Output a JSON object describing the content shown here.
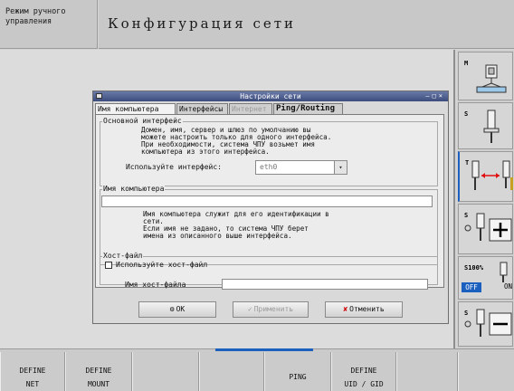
{
  "header": {
    "mode_line1": "Режим ручного",
    "mode_line2": "управления",
    "title": "Конфигурация сети"
  },
  "dialog": {
    "title": "Настройки сети",
    "tabs": [
      {
        "label": "Имя компьютера",
        "state": "selected"
      },
      {
        "label": "Интерфейсы",
        "state": "normal"
      },
      {
        "label": "Интернет",
        "state": "disabled"
      },
      {
        "label": "Ping/Routing",
        "state": "normal"
      }
    ],
    "main_interface": {
      "group_title": "Основной интерфейс",
      "line1": "Домен, имя, сервер и шлюз по умолчанию вы",
      "line2": "можете настроить только для одного интерфейса.",
      "line3": "При необходимости, система ЧПУ возьмет имя",
      "line4": "компьютера из этого интерфейса.",
      "use_interface_label": "Используйте интерфейс:",
      "interface_value": "eth0"
    },
    "computer_name": {
      "group_title": "Имя компьютера",
      "value": "",
      "line1": "Имя компьютера служит для его идентификации в",
      "line2": "сети.",
      "line3": "Если имя не задано, то система ЧПУ берет",
      "line4": "имена из описанного выше интерфейса."
    },
    "host_file": {
      "group_title": "Хост-файл",
      "checkbox_label": "Используйте хост-файл",
      "checkbox_checked": false,
      "name_label": "Имя хост-файла",
      "name_value": ""
    },
    "buttons": {
      "ok": "OK",
      "apply": "Применить",
      "cancel": "Отменить"
    }
  },
  "side_softkeys": [
    {
      "label": "M"
    },
    {
      "label": "S"
    },
    {
      "label": "T"
    },
    {
      "label": "S"
    },
    {
      "label": "S100%",
      "off": "OFF",
      "on": "ON"
    },
    {
      "label": "S"
    }
  ],
  "bottom_softkeys": [
    {
      "line1": "DEFINE",
      "line2": "NET"
    },
    {
      "line1": "DEFINE",
      "line2": "MOUNT"
    },
    {
      "line1": "",
      "line2": ""
    },
    {
      "line1": "",
      "line2": ""
    },
    {
      "line1": "PING",
      "line2": ""
    },
    {
      "line1": "DEFINE",
      "line2": "UID / GID"
    },
    {
      "line1": "",
      "line2": ""
    },
    {
      "line1": "",
      "line2": ""
    }
  ],
  "colors": {
    "accent": "#1b5fbf",
    "titlebar": "#4a5a8a",
    "arrow": "#e01010"
  }
}
